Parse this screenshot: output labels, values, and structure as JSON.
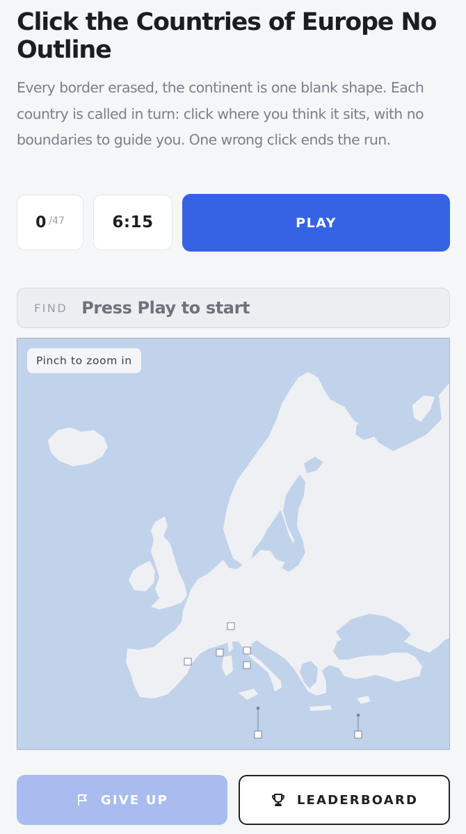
{
  "header": {
    "title": "Click the Countries of Europe No Outline",
    "description": "Every border erased, the continent is one blank shape. Each country is called in turn: click where you think it sits, with no boundaries to guide you. One wrong click ends the run."
  },
  "stats": {
    "score": "0",
    "total": "/47",
    "timer": "6:15"
  },
  "controls": {
    "play_label": "PLAY",
    "give_up_label": "GIVE UP",
    "leaderboard_label": "LEADERBOARD"
  },
  "find": {
    "label": "FIND",
    "prompt": "Press Play to start"
  },
  "map": {
    "hint": "Pinch to zoom in",
    "sea_color": "#c0d3ea",
    "land_color": "#eff0f4",
    "micro_state_markers": [
      "Andorra",
      "Monaco",
      "Liechtenstein",
      "San Marino",
      "Vatican City",
      "Malta",
      "Cyprus"
    ]
  },
  "colors": {
    "accent": "#3563e4",
    "give_up_disabled": "#a9bcef"
  }
}
